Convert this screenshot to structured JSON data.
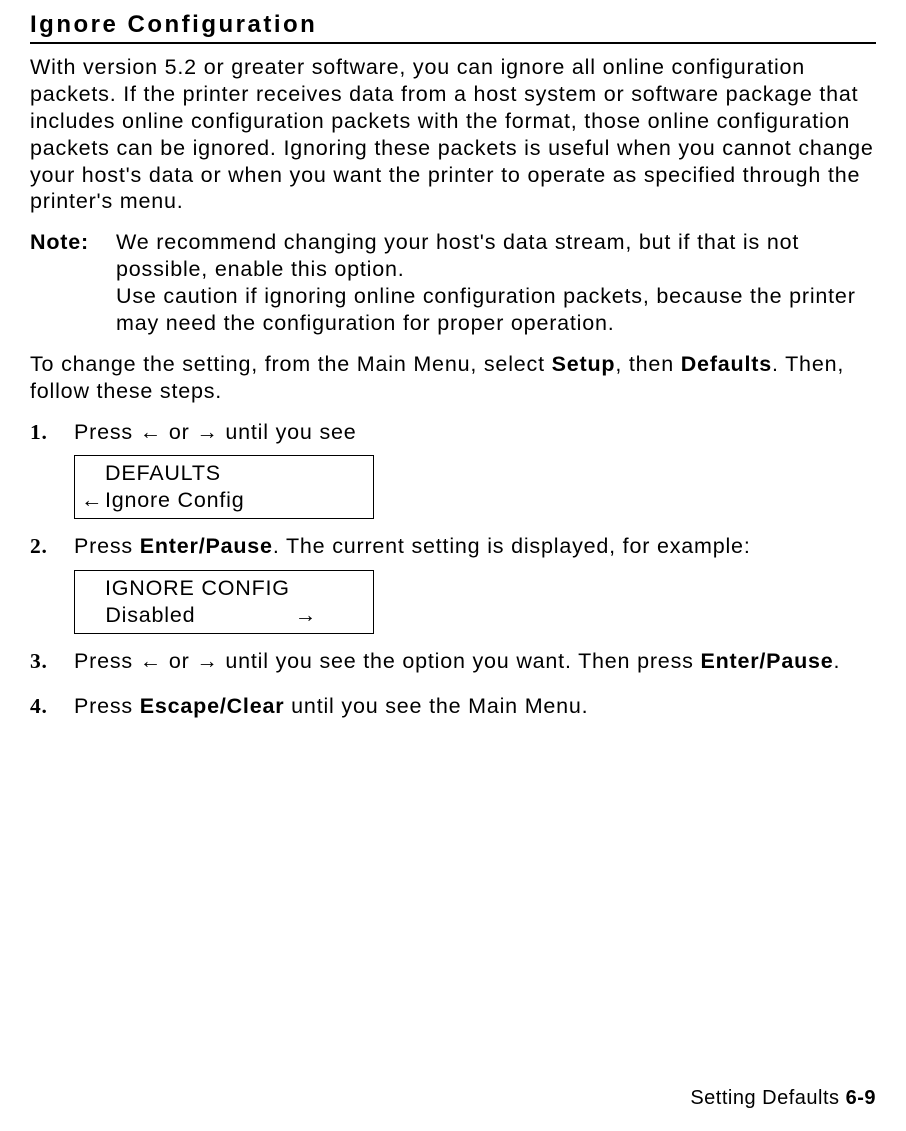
{
  "section": {
    "title": "Ignore Configuration",
    "intro": "With version 5.2 or greater software, you can ignore all online configuration packets.  If the printer receives data from a host system or software package that includes online configuration packets with the format, those online configuration packets can be ignored.  Ignoring these packets is useful when you cannot change your host's data or when you want the printer to operate as specified through the printer's menu.",
    "note": {
      "label": "Note:",
      "line1": "We recommend changing your host's data stream, but if that is not possible, enable this option.",
      "line2": "Use caution if ignoring online configuration packets, because the printer may need the configuration for proper operation."
    },
    "nav_pre": "To change the setting, from the Main Menu, select ",
    "nav_setup": "Setup",
    "nav_mid": ", then ",
    "nav_defaults": "Defaults",
    "nav_post": ". Then, follow these steps."
  },
  "arrows": {
    "left": "←",
    "right": "→"
  },
  "steps": {
    "s1": {
      "num": "1.",
      "pre": "Press ",
      "mid": " or ",
      "post": " until you see"
    },
    "s2": {
      "num": "2.",
      "pre": "Press ",
      "button": "Enter/Pause",
      "post": ".  The current setting is displayed, for example:"
    },
    "s3": {
      "num": "3.",
      "pre": "Press ",
      "mid": " or ",
      "post1": " until you see the option you want.  Then press ",
      "button": "Enter/Pause",
      "post2": "."
    },
    "s4": {
      "num": "4.",
      "pre": "Press ",
      "button": "Escape/Clear",
      "post": " until you see the Main Menu."
    }
  },
  "display1": {
    "line1": "DEFAULTS",
    "line2": "Ignore Config"
  },
  "display2": {
    "line1": "IGNORE CONFIG",
    "line2": "Disabled"
  },
  "footer": {
    "text": "Setting Defaults  ",
    "page": "6-9"
  }
}
